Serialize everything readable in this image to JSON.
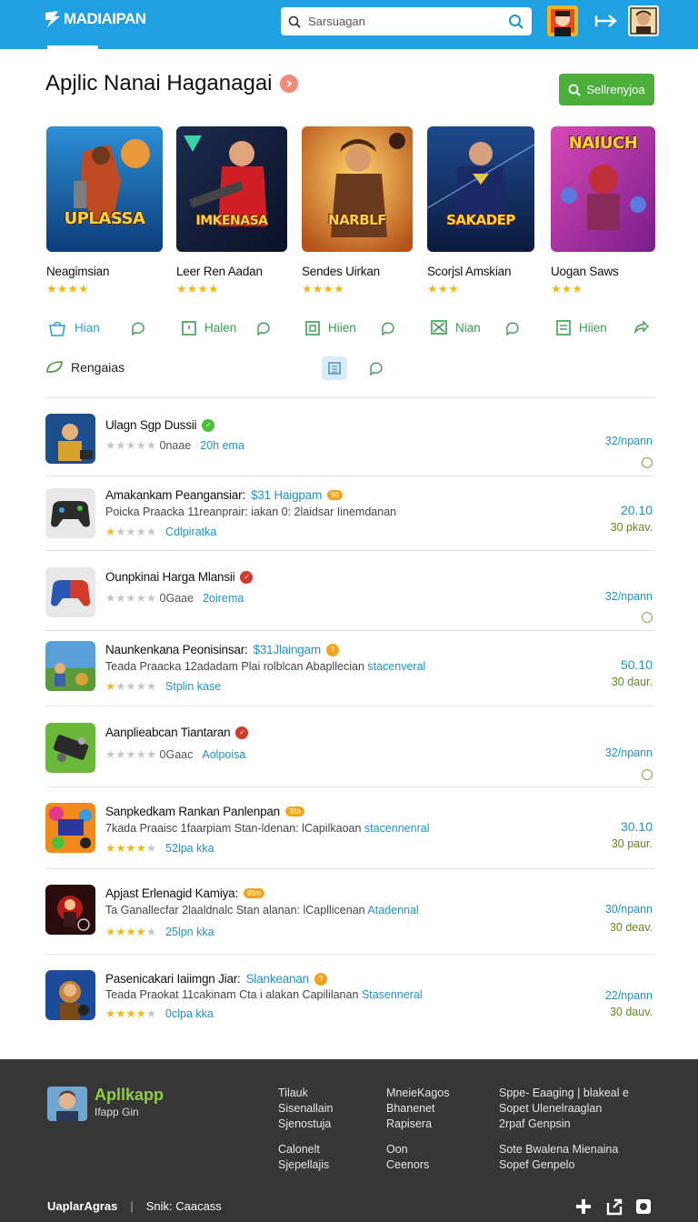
{
  "header": {
    "logo_text": "MADIAIPAN",
    "search_placeholder": "Sarsuagan"
  },
  "page": {
    "title": "Apjlic Nanai Haganagai",
    "action_button": "Sellrenyjoa"
  },
  "featured": [
    {
      "name": "Neagimsian",
      "cover_text": "UPLASSA",
      "stars": "★★★★",
      "action": "Hian"
    },
    {
      "name": "Leer Ren Aadan",
      "cover_text": "IMKENASA",
      "stars": "★★★★",
      "action": "Halen"
    },
    {
      "name": "Sendes Uirkan",
      "cover_text": "NARBLF",
      "stars": "★★★★",
      "action": "Hiien"
    },
    {
      "name": "Scorjsl Amskian",
      "cover_text": "SAKADEP",
      "stars": "★★★",
      "action": "Nian"
    },
    {
      "name": "Uogan Saws",
      "cover_text": "NAIUCH",
      "stars": "★★★",
      "action": "Hiien"
    }
  ],
  "filter": {
    "label": "Rengaias"
  },
  "list": [
    {
      "title": "Ulagn Sgp Dussii",
      "title_hl": "",
      "badge": "",
      "sub": "",
      "sub_hl": "",
      "stars_y": "",
      "stars_g": "★★★★★",
      "meta": "0naae",
      "link": "20h ema",
      "price": "32/npann",
      "days": ""
    },
    {
      "title": "Amakankam Peangansiar:",
      "title_hl": "$31 Haigpam",
      "badge": "90",
      "sub": "Poicka Praacka 11reanprair: iakan 0: 2laidsar Iinemdanan",
      "sub_hl": "",
      "stars_y": "★",
      "stars_g": "★★★★",
      "meta": "",
      "link": "Cdlpiratka",
      "price": "20.10",
      "days": "30 pkav."
    },
    {
      "title": "Ounpkinai Harga Mlansii",
      "title_hl": "",
      "badge": "",
      "sub": "",
      "sub_hl": "",
      "stars_y": "",
      "stars_g": "★★★★★",
      "meta": "0Gaae",
      "link": "2oirema",
      "price": "32/npann",
      "days": ""
    },
    {
      "title": "Naunkenkana Peonisinsar:",
      "title_hl": "$31Jlaingam",
      "badge": "",
      "sub": "Teada Praacka 12adadam Plai rolblcan Abapllecian",
      "sub_hl": "stacenveral",
      "stars_y": "★",
      "stars_g": "★★★★",
      "meta": "",
      "link": "Stplin kase",
      "price": "50.10",
      "days": "30 daur."
    },
    {
      "title": "Aanplieabcan Tiantaran",
      "title_hl": "",
      "badge": "",
      "sub": "",
      "sub_hl": "",
      "stars_y": "",
      "stars_g": "★★★★★",
      "meta": "0Gaac",
      "link": "Aolpoisa",
      "price": "32/npann",
      "days": ""
    },
    {
      "title": "Sanpkedkam Rankan Panlenpan",
      "title_hl": "",
      "badge": "35b",
      "sub": "7kada Praaisc 1faarpiam Stan-ldenan: lCapilkaoan",
      "sub_hl": "stacennenral",
      "stars_y": "★★★★",
      "stars_g": "★",
      "meta": "",
      "link": "52lpa kka",
      "price": "30.10",
      "days": "30 paur."
    },
    {
      "title": "Apjast Erlenagid Kamiya:",
      "title_hl": "",
      "badge": "99m",
      "sub": "Ta Ganallecfar 2laaldnalc Stan alanan: lCapllicenan",
      "sub_hl": "Atadennal",
      "stars_y": "★★★★",
      "stars_g": "★",
      "meta": "",
      "link": "25lpn kka",
      "price": "30/npann",
      "days": "30 deav."
    },
    {
      "title": "Pasenicakari Iaiimgn Jiar:",
      "title_hl": "Slankeanan",
      "badge": "",
      "sub": "Teada Praokat 11cakinam Cta i alakan Capililanan",
      "sub_hl": "Stasenneral",
      "stars_y": "★★★★",
      "stars_g": "★",
      "meta": "",
      "link": "0clpa kka",
      "price": "22/npann",
      "days": "30 dauv."
    }
  ],
  "footer": {
    "brand": "Apllkapp",
    "tagline": "Ifapp Gin",
    "col1": [
      "Tilauk",
      "Sisenallain",
      "Sjenostuja",
      "",
      "Calonelt",
      "Sjepellajis"
    ],
    "col2": [
      "MneieKagos",
      "Bhanenet",
      "Rapisera",
      "",
      "Oon",
      "Ceenors"
    ],
    "col3": [
      "Sppe- Eaaging | blakeal e",
      "Sopet Ulenelraaglan",
      "2rpaf Genpsin",
      "",
      "Sote Bwalena Mienaina",
      "Sopef Genpelo"
    ],
    "bottom_left": "UaplarAgras",
    "bottom_sep": "|",
    "bottom_right": "Snik: Caacass"
  },
  "colors": {
    "topbar": "#1ea0e3",
    "accent_green": "#4caf3a",
    "link_blue": "#1e93c8",
    "star": "#f2b81b",
    "footer_bg": "#363636"
  }
}
